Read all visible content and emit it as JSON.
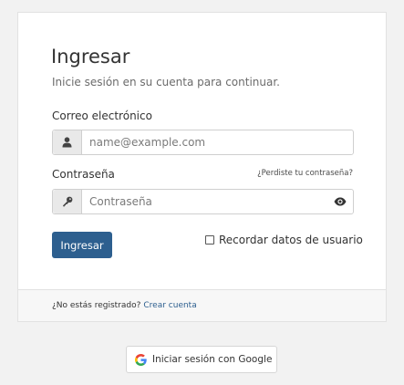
{
  "login": {
    "title": "Ingresar",
    "subtitle": "Inicie sesión en su cuenta para continuar.",
    "email_label": "Correo electrónico",
    "email_placeholder": "name@example.com",
    "email_value": "",
    "password_label": "Contraseña",
    "password_placeholder": "Contraseña",
    "password_value": "",
    "forgot_link": "¿Perdiste tu contraseña?",
    "submit_label": "Ingresar",
    "remember_label": "Recordar datos de usuario",
    "remember_checked": false
  },
  "footer": {
    "prompt": "¿No estás registrado?",
    "register_link": "Crear cuenta"
  },
  "google": {
    "label": "Iniciar sesión con Google"
  },
  "icons": {
    "email_addon": "user-icon",
    "password_addon": "key-icon",
    "password_toggle": "eye-icon",
    "google": "google-logo-icon"
  },
  "colors": {
    "primary": "#2d5f8f",
    "background": "#f2f2f2",
    "card": "#ffffff"
  }
}
